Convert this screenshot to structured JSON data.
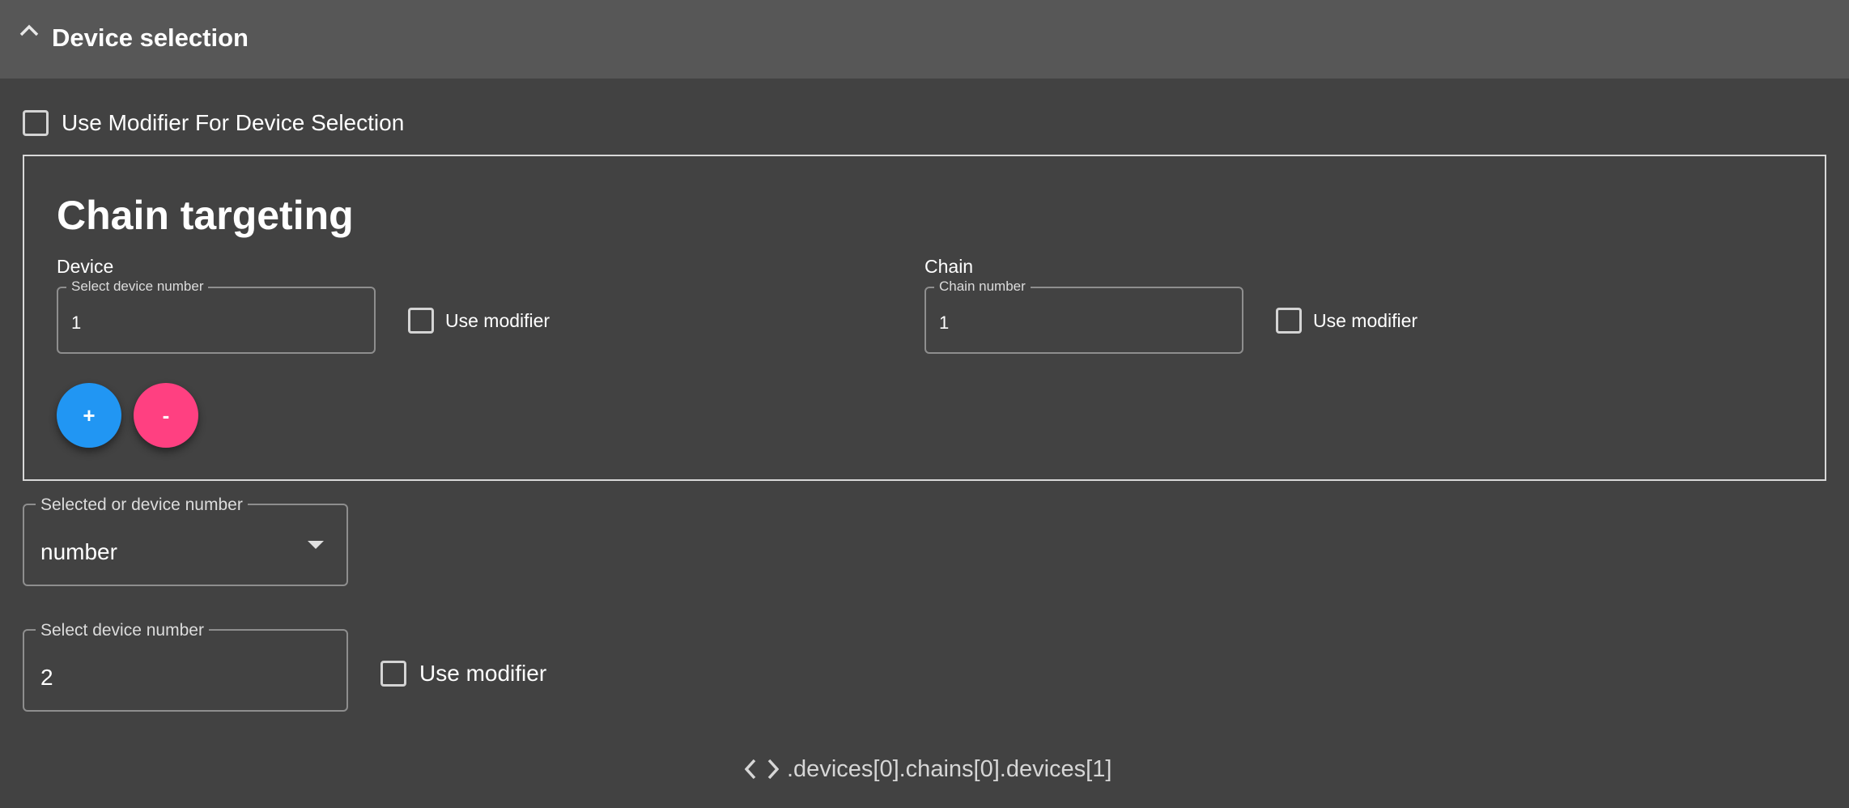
{
  "section": {
    "title": "Device selection",
    "collapse_icon": "chevron-up-icon"
  },
  "use_modifier_device_selection": {
    "label": "Use Modifier For Device Selection",
    "checked": false
  },
  "chain_targeting": {
    "heading": "Chain targeting",
    "device": {
      "label": "Device",
      "field_label": "Select device number",
      "value": "1",
      "modifier_label": "Use modifier"
    },
    "chain": {
      "label": "Chain",
      "field_label": "Chain number",
      "value": "1",
      "modifier_label": "Use modifier"
    },
    "add_label": "+",
    "remove_label": "-",
    "colors": {
      "add": "#2196f3",
      "remove": "#ff4081"
    }
  },
  "selected_or_device": {
    "field_label": "Selected or device number",
    "value": "number",
    "dropdown_icon": "caret-down-icon"
  },
  "device_number": {
    "field_label": "Select device number",
    "value": "2",
    "modifier_label": "Use modifier"
  },
  "path": {
    "icon": "code-icon",
    "text": ".devices[0].chains[0].devices[1]"
  }
}
